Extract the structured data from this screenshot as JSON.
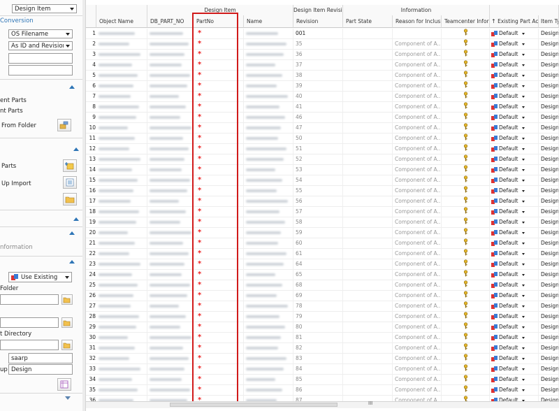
{
  "left_panel": {
    "type_select": {
      "value": "Design Item"
    },
    "conversion": {
      "title": "Conversion",
      "filename_select": {
        "value": "OS Filename"
      },
      "id_select": {
        "value": "As ID and Revision"
      },
      "field1": "",
      "field2": ""
    },
    "parts": {
      "item1": "ent Parts",
      "item2": "nt Parts",
      "from_folder": "From Folder"
    },
    "import": {
      "parts_label": "Parts",
      "up_import_label": "Up Import"
    },
    "information_label": "nformation",
    "options": {
      "existing_select": {
        "value": "Use Existing"
      },
      "folder_label": "Folder",
      "folder_value": "",
      "field3": "",
      "directory_label": "t Directory",
      "directory_value": "",
      "user_value": "saarp",
      "group_label": "up",
      "group_value": "Design"
    }
  },
  "grid": {
    "group_headers": {
      "design_item": "Design Item",
      "design_item_revision": "Design Item Revision",
      "information": "Information"
    },
    "columns": {
      "object_name": "Object Name",
      "db_part_no": "DB_PART_NO",
      "part_no": "PartNo",
      "name": "Name",
      "revision": "Revision",
      "part_state": "Part State",
      "reason": "Reason for Inclusion",
      "teamcenter": "Teamcenter Informa",
      "existing": "Existing Part Ac",
      "item_type": "Item Ty"
    },
    "required_marker": "*",
    "reason_text": "Component of A...",
    "existing_value": "Default",
    "item_type_value": "Design",
    "rows": [
      {
        "n": "1",
        "rev": "001",
        "reason": ""
      },
      {
        "n": "2",
        "rev": "35",
        "reason": "Component of A..."
      },
      {
        "n": "3",
        "rev": "36",
        "reason": "Component of A..."
      },
      {
        "n": "4",
        "rev": "37",
        "reason": "Component of A..."
      },
      {
        "n": "5",
        "rev": "38",
        "reason": "Component of A..."
      },
      {
        "n": "6",
        "rev": "39",
        "reason": "Component of A..."
      },
      {
        "n": "7",
        "rev": "40",
        "reason": "Component of A..."
      },
      {
        "n": "8",
        "rev": "41",
        "reason": "Component of A..."
      },
      {
        "n": "9",
        "rev": "46",
        "reason": "Component of A..."
      },
      {
        "n": "10",
        "rev": "47",
        "reason": "Component of A..."
      },
      {
        "n": "11",
        "rev": "50",
        "reason": "Component of A..."
      },
      {
        "n": "12",
        "rev": "51",
        "reason": "Component of A..."
      },
      {
        "n": "13",
        "rev": "52",
        "reason": "Component of A..."
      },
      {
        "n": "14",
        "rev": "53",
        "reason": "Component of A..."
      },
      {
        "n": "15",
        "rev": "54",
        "reason": "Component of A..."
      },
      {
        "n": "16",
        "rev": "55",
        "reason": "Component of A..."
      },
      {
        "n": "17",
        "rev": "56",
        "reason": "Component of A..."
      },
      {
        "n": "18",
        "rev": "57",
        "reason": "Component of A..."
      },
      {
        "n": "19",
        "rev": "58",
        "reason": "Component of A..."
      },
      {
        "n": "20",
        "rev": "59",
        "reason": "Component of A..."
      },
      {
        "n": "21",
        "rev": "60",
        "reason": "Component of A..."
      },
      {
        "n": "22",
        "rev": "61",
        "reason": "Component of A..."
      },
      {
        "n": "23",
        "rev": "64",
        "reason": "Component of A..."
      },
      {
        "n": "24",
        "rev": "65",
        "reason": "Component of A..."
      },
      {
        "n": "25",
        "rev": "68",
        "reason": "Component of A..."
      },
      {
        "n": "26",
        "rev": "69",
        "reason": "Component of A..."
      },
      {
        "n": "27",
        "rev": "78",
        "reason": "Component of A..."
      },
      {
        "n": "28",
        "rev": "79",
        "reason": "Component of A..."
      },
      {
        "n": "29",
        "rev": "80",
        "reason": "Component of A..."
      },
      {
        "n": "30",
        "rev": "81",
        "reason": "Component of A..."
      },
      {
        "n": "31",
        "rev": "82",
        "reason": "Component of A..."
      },
      {
        "n": "32",
        "rev": "83",
        "reason": "Component of A..."
      },
      {
        "n": "33",
        "rev": "84",
        "reason": "Component of A..."
      },
      {
        "n": "34",
        "rev": "85",
        "reason": "Component of A..."
      },
      {
        "n": "35",
        "rev": "86",
        "reason": "Component of A..."
      },
      {
        "n": "36",
        "rev": "87",
        "reason": "Component of A..."
      }
    ]
  },
  "scrollbar": {
    "grip": "III"
  },
  "colors": {
    "accent": "#2e75b6",
    "required": "#e22222",
    "highlight_box": "#d11a1a"
  }
}
